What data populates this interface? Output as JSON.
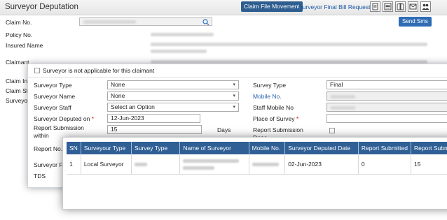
{
  "header": {
    "title": "Surveyor Deputation",
    "claim_file_movement": "Claim File Movement",
    "final_bill_request": "Surveyor Final Bill Request",
    "icons": [
      "document-icon",
      "list-icon",
      "book-icon",
      "mail-icon",
      "users-icon"
    ]
  },
  "claim_form": {
    "claim_no_label": "Claim No.",
    "send_sms": "Send Sms",
    "policy_no_label": "Policy No.",
    "insured_name_label": "Insured Name",
    "claimant_label": "Claimant",
    "claim_in_label": "Claim In",
    "claim_st_label": "Claim St",
    "surveyor_label": "Surveyo",
    "report_no_label": "Report No.",
    "surveyor_fe_label": "Surveyor Fe",
    "tds_label": "TDS"
  },
  "survey_dialog": {
    "not_applicable_label": "Surveyor is not applicable for this claimant",
    "surveyor_type_label": "Surveyor Type",
    "surveyor_type_value": "None",
    "surveyor_name_label": "Surveyor Name",
    "surveyor_name_value": "None",
    "surveyor_staff_label": "Surveyor Staff",
    "surveyor_staff_value": "Select an Option",
    "deputed_on_label": "Surveyor Deputed on",
    "deputed_on_value": "12-Jun-2023",
    "report_submission_label": "Report Submission",
    "report_submission_label2": "within",
    "report_submission_value": "15",
    "days_label": "Days",
    "survey_type_label": "Survey Type",
    "survey_type_value": "Final",
    "mobile_no_label": "Mobile No.",
    "staff_mobile_label": "Staff Mobile No",
    "place_of_survey_label": "Place of Survey",
    "report_submission_done_label": "Report Submission",
    "report_submission_done_label2": "Done",
    "required_mark": "*"
  },
  "grid": {
    "columns": [
      "SN",
      "Surveyour Type",
      "Survey Type",
      "Name of Surveyor",
      "Mobile No.",
      "Surveyor Deputed Date",
      "Report Submitted",
      "Report Submi"
    ],
    "rows": [
      {
        "sn": "1",
        "surveyor_type": "Local Surveyor",
        "deputed_date": "02-Jun-2023",
        "report_submitted": "0",
        "report_submit_days": "15"
      }
    ]
  }
}
